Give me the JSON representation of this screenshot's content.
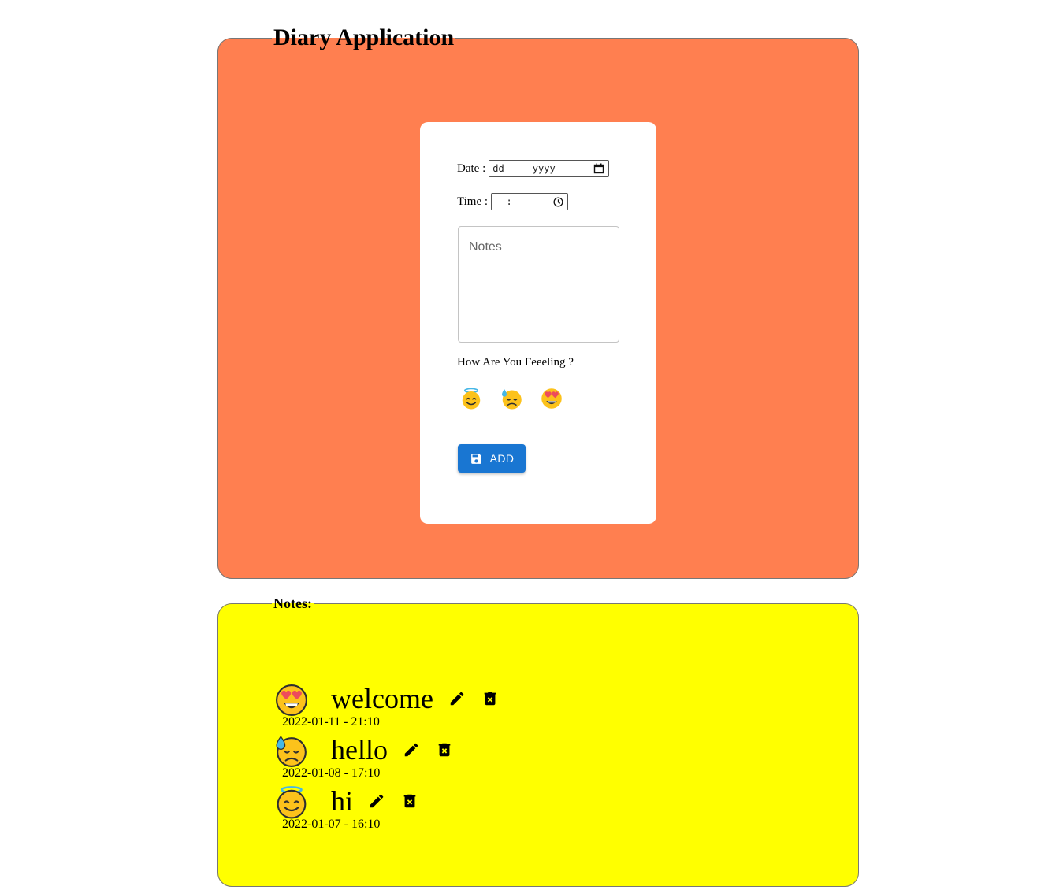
{
  "app": {
    "title": "Diary Application",
    "panel_color": "#ff7f50"
  },
  "form": {
    "date_label": "Date :",
    "date_placeholder": "dd-----yyyy",
    "time_label": "Time :",
    "time_placeholder": "--:-- --",
    "notes_placeholder": "Notes",
    "feeling_label": "How Are You Feeeling ?",
    "moods": [
      "smiling-face-with-halo",
      "downcast-face-with-sweat",
      "smiling-face-with-heart-eyes"
    ],
    "add_label": "ADD",
    "add_color": "#1976d2"
  },
  "notes": {
    "title": "Notes:",
    "panel_color": "#ffff00",
    "entries": [
      {
        "text": "welcome",
        "timestamp": "2022-01-11 - 21:10",
        "mood": "smiling-face-with-heart-eyes"
      },
      {
        "text": "hello",
        "timestamp": "2022-01-08 - 17:10",
        "mood": "downcast-face-with-sweat"
      },
      {
        "text": "hi",
        "timestamp": "2022-01-07 - 16:10",
        "mood": "smiling-face-with-halo"
      }
    ]
  }
}
